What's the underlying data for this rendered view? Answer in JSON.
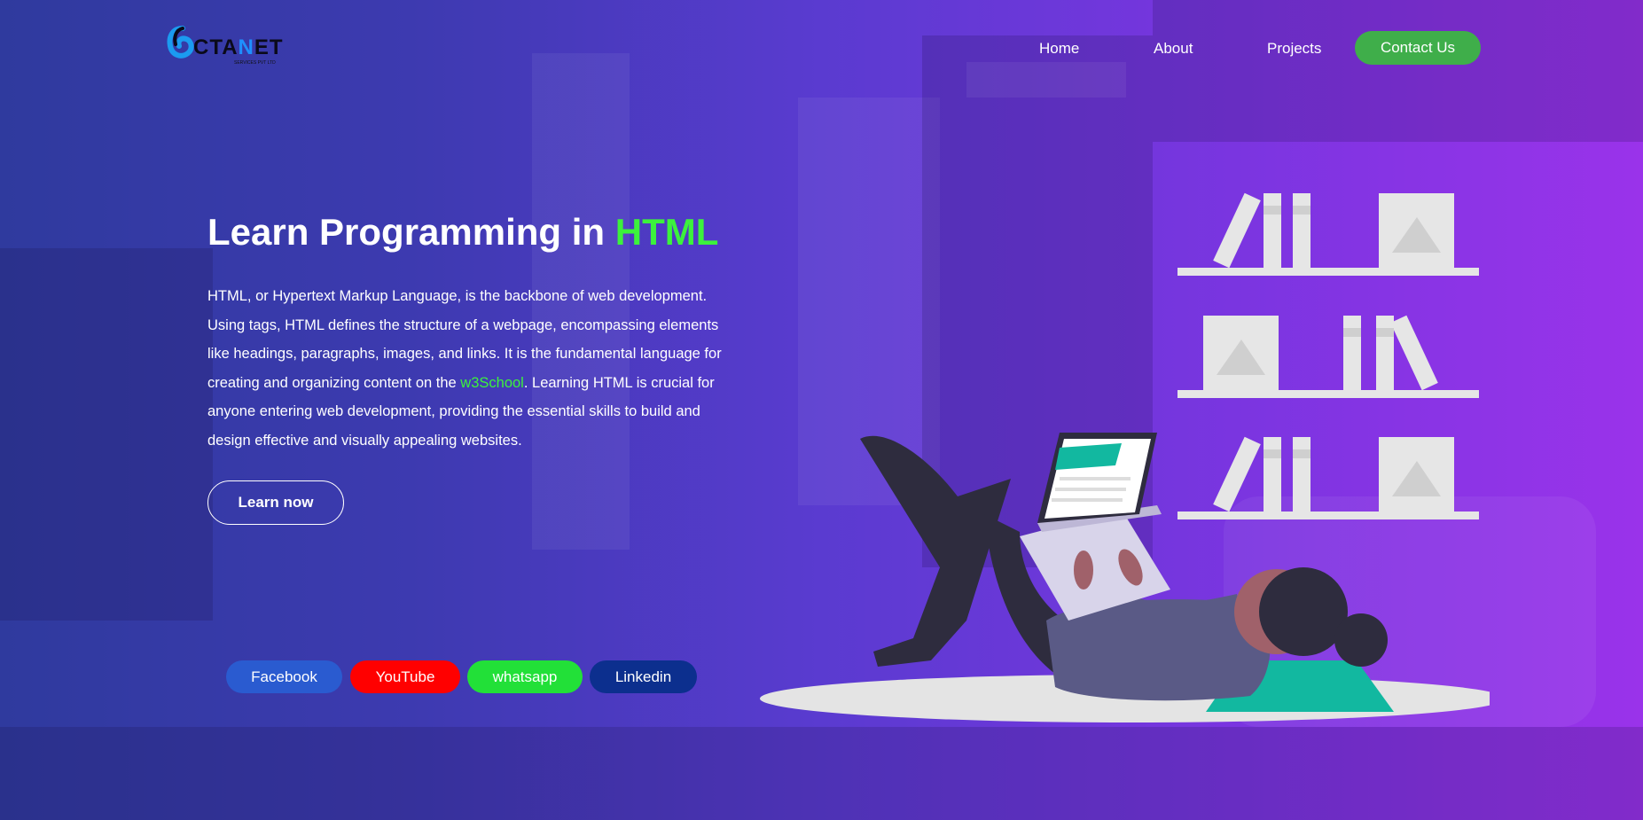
{
  "nav": {
    "logo": {
      "text_prefix": "CTA",
      "text_highlight": "N",
      "text_suffix": "ET",
      "tagline": "SERVICES PVT LTD"
    },
    "links": [
      "Home",
      "About",
      "Projects"
    ],
    "contact_label": "Contact Us"
  },
  "hero": {
    "title_main": "Learn Programming in ",
    "title_accent": "HTML",
    "paragraph_before": "HTML, or Hypertext Markup Language, is the backbone of web development. Using tags, HTML defines the structure of a webpage, encompassing elements like headings, paragraphs, images, and links. It is the fundamental language for creating and organizing content on the ",
    "paragraph_link": "w3School",
    "paragraph_after": ". Learning HTML is crucial for anyone entering web development, providing the essential skills to build and design effective and visually appealing websites.",
    "cta_label": "Learn now"
  },
  "social": [
    {
      "label": "Facebook",
      "color": "#2a5bd0"
    },
    {
      "label": "YouTube",
      "color": "#ff0000"
    },
    {
      "label": "whatsapp",
      "color": "#22e038"
    },
    {
      "label": "Linkedin",
      "color": "#0c2f8e"
    }
  ],
  "colors": {
    "accent_green": "#3cf23c",
    "contact_green": "#3fae4a",
    "bg_left": "#2f3a9e",
    "bg_right": "#9a33ea"
  },
  "icons": {
    "illustration": "person-reading-laptop-bookshelf-illustration"
  }
}
